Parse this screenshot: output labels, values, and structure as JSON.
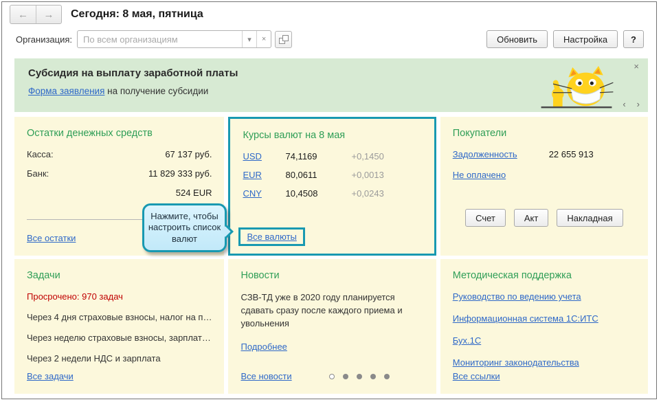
{
  "header": {
    "title": "Сегодня: 8 мая, пятница"
  },
  "toolbar": {
    "org_label": "Организация:",
    "org_placeholder": "По всем организациям",
    "refresh_label": "Обновить",
    "settings_label": "Настройка",
    "help_label": "?"
  },
  "banner": {
    "title": "Субсидия на выплату заработной платы",
    "link_label": "Форма заявления",
    "link_suffix": " на получение субсидии"
  },
  "panels": {
    "cash": {
      "title": "Остатки денежных средств",
      "rows": [
        {
          "label": "Касса:",
          "value": "67 137 руб."
        },
        {
          "label": "Банк:",
          "value": "11 829 333 руб."
        },
        {
          "label": "",
          "value": "524 EUR"
        }
      ],
      "all_link": "Все остатки"
    },
    "currency": {
      "title": "Курсы валют на 8 мая",
      "rows": [
        {
          "code": "USD",
          "rate": "74,1169",
          "delta": "+0,1450"
        },
        {
          "code": "EUR",
          "rate": "80,0611",
          "delta": "+0,0013"
        },
        {
          "code": "CNY",
          "rate": "10,4508",
          "delta": "+0,0243"
        }
      ],
      "all_link": "Все валюты"
    },
    "buyers": {
      "title": "Покупатели",
      "debt_link": "Задолженность",
      "debt_value": "22 655 913",
      "unpaid_link": "Не оплачено",
      "buttons": [
        "Счет",
        "Акт",
        "Накладная"
      ]
    },
    "tasks": {
      "title": "Задачи",
      "overdue": "Просрочено: 970 задач",
      "items": [
        "Через 4 дня страховые взносы, налог на п…",
        "Через неделю страховые взносы, зарплат…",
        "Через 2 недели НДС и зарплата"
      ],
      "all_link": "Все задачи"
    },
    "news": {
      "title": "Новости",
      "text": "СЗВ-ТД уже в 2020 году планируется сдавать сразу после каждого приема и увольнения",
      "more_link": "Подробнее",
      "all_link": "Все новости",
      "pager_dots": 5,
      "active_dot": 1
    },
    "support": {
      "title": "Методическая поддержка",
      "links": [
        "Руководство по ведению учета",
        "Информационная система 1С:ИТС",
        "Бух.1С",
        "Мониторинг законодательства"
      ],
      "all_link": "Все ссылки"
    }
  },
  "tooltip": {
    "text": "Нажмите, чтобы настроить список валют"
  },
  "icons": {
    "back": "←",
    "forward": "→",
    "dropdown": "▾",
    "clear": "×",
    "close": "×",
    "prev": "‹",
    "next": "›"
  },
  "colors": {
    "accent": "#1899b1",
    "panel-bg": "#fcf8dc",
    "banner-bg": "#d7ead3",
    "title-green": "#2f9e57",
    "link-blue": "#2e68c8",
    "red": "#c00000",
    "delta-gray": "#9b9b9b",
    "tooltip-bg": "#cdeffd"
  }
}
